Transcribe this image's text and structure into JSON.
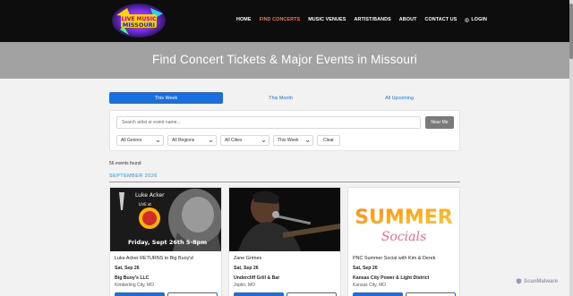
{
  "header": {
    "logo_text": "LIVE MUSIC MISSOURI",
    "nav": [
      {
        "label": "HOME"
      },
      {
        "label": "FIND CONCERTS"
      },
      {
        "label": "MUSIC VENUES"
      },
      {
        "label": "ARTIST/BANDS"
      },
      {
        "label": "ABOUT"
      },
      {
        "label": "CONTACT US"
      }
    ],
    "login_label": "LOGIN",
    "active_nav": "FIND CONCERTS"
  },
  "hero": {
    "title": "Find Concert Tickets & Major Events in Missouri"
  },
  "tabs": [
    {
      "label": "This Week",
      "active": true
    },
    {
      "label": "This Month",
      "active": false
    },
    {
      "label": "All Upcoming",
      "active": false
    }
  ],
  "filters": {
    "search_placeholder": "Search artist or event name...",
    "near_me_label": "Near Me",
    "genres": "All Genres",
    "regions": "All Regions",
    "cities": "All Cities",
    "period": "This Week",
    "clear_label": "Clear"
  },
  "results": {
    "count_text": "56 events found",
    "month_heading": "SEPTEMBER 2026"
  },
  "events": [
    {
      "image_text_1": "Luke Acker",
      "image_text_2": "LIVE at",
      "image_text_3": "Friday, Sept 26th 5-8pm",
      "title": "Luke Acker RETURNS to Big Buoy's!",
      "date": "Sat, Sep 26",
      "venue": "Big Buoy's LLC",
      "city": "Kimberling City, MO"
    },
    {
      "title": "Zane Grimes",
      "date": "Sat, Sep 26",
      "venue": "Undercliff Grill & Bar",
      "city": "Joplin, MO"
    },
    {
      "image_text_1": "SUMMER",
      "image_text_2": "Socials",
      "title": "PNC Summer Social with Kim & Derek",
      "date": "Sat, Sep 26",
      "venue": "Kansas City Power & Light District",
      "city": "Kansas City, MO"
    }
  ],
  "watermark": "ScanMalware",
  "colors": {
    "accent_blue": "#1a6fe0",
    "nav_active": "#ff7a1a",
    "hero_bg": "#a2a2a2",
    "header_bg": "#0d0d0d"
  }
}
